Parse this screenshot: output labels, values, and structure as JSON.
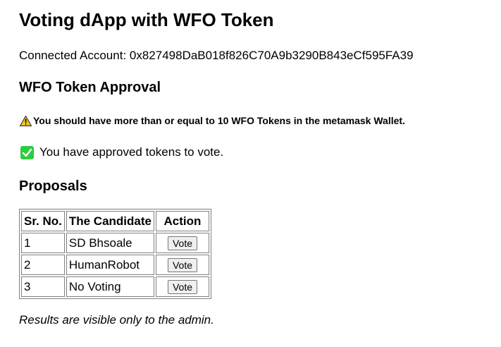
{
  "title": "Voting dApp with WFO Token",
  "account": {
    "text": "Connected Account: 0x827498DaB018f826C70A9b3290B843eCf595FA39"
  },
  "approval": {
    "heading": "WFO Token Approval",
    "warning_icon": "warning-icon",
    "warning_text": "You should have more than or equal to 10 WFO Tokens in the metamask Wallet.",
    "approved_icon": "check-mark-icon",
    "approved_text": "You have approved tokens to vote.",
    "warning_color": "#f5c518",
    "check_color": "#2ecc40"
  },
  "proposals": {
    "heading": "Proposals",
    "columns": [
      "Sr. No.",
      "The Candidate",
      "Action"
    ],
    "rows": [
      {
        "sr": "1",
        "candidate": "SD Bhsoale",
        "action": "Vote"
      },
      {
        "sr": "2",
        "candidate": "HumanRobot",
        "action": "Vote"
      },
      {
        "sr": "3",
        "candidate": "No Voting",
        "action": "Vote"
      }
    ]
  },
  "results_note": "Results are visible only to the admin."
}
